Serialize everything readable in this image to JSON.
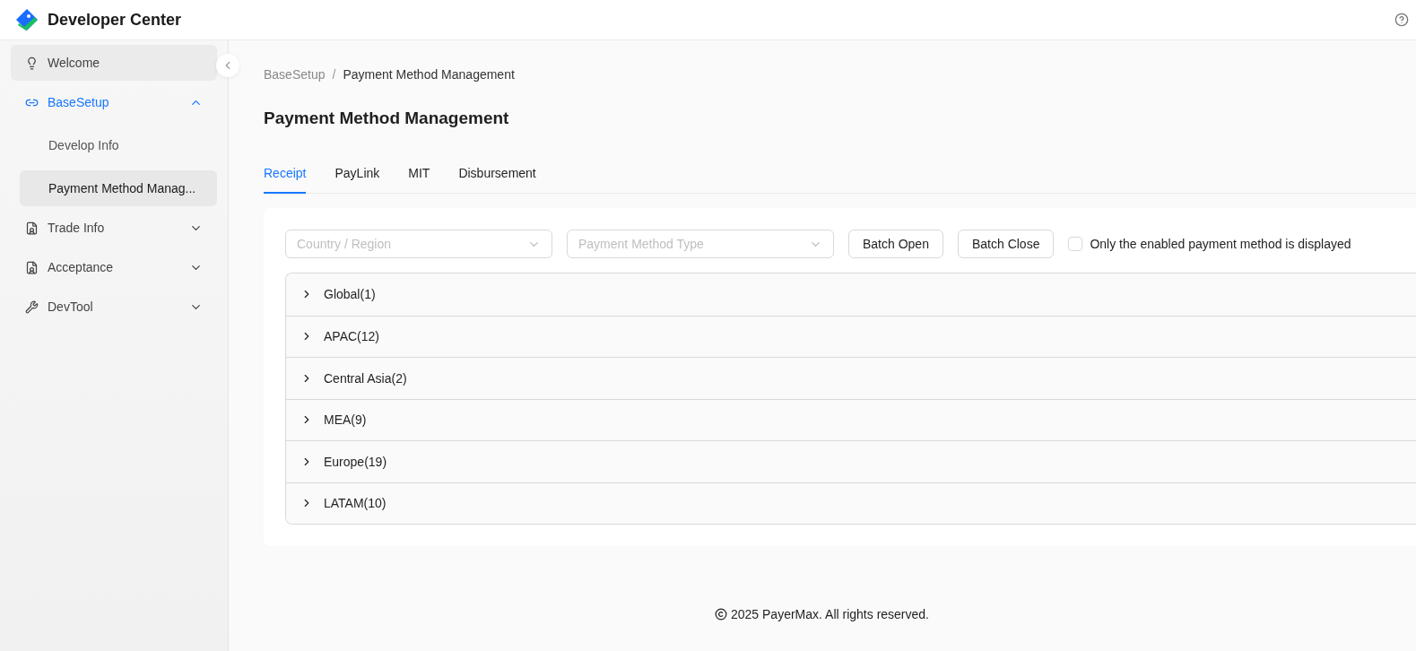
{
  "header": {
    "title": "Developer Center"
  },
  "sidebar": {
    "items": [
      {
        "label": "Welcome",
        "hovered": true,
        "active": false
      },
      {
        "label": "BaseSetup",
        "active": true,
        "expanded": true,
        "children": [
          {
            "label": "Develop Info",
            "selected": false
          },
          {
            "label": "Payment Method Manag...",
            "selected": true
          }
        ]
      },
      {
        "label": "Trade Info",
        "active": false,
        "expanded": false
      },
      {
        "label": "Acceptance",
        "active": false,
        "expanded": false
      },
      {
        "label": "DevTool",
        "active": false,
        "expanded": false
      }
    ]
  },
  "breadcrumb": {
    "separator": "/",
    "items": [
      "BaseSetup",
      "Payment Method Management"
    ]
  },
  "page_title": "Payment Method Management",
  "tabs": [
    {
      "label": "Receipt",
      "selected": true
    },
    {
      "label": "PayLink",
      "selected": false
    },
    {
      "label": "MIT",
      "selected": false
    },
    {
      "label": "Disbursement",
      "selected": false
    }
  ],
  "filters": {
    "selects": [
      {
        "placeholder": "Country / Region"
      },
      {
        "placeholder": "Payment Method Type"
      }
    ],
    "buttons": [
      "Batch Open",
      "Batch Close"
    ],
    "checkbox": {
      "label": "Only the enabled payment method is displayed",
      "checked": false
    }
  },
  "regions": [
    {
      "label": "Global(1)",
      "expanded": false
    },
    {
      "label": "APAC(12)",
      "expanded": false
    },
    {
      "label": "Central Asia(2)",
      "expanded": false
    },
    {
      "label": "MEA(9)",
      "expanded": false
    },
    {
      "label": "Europe(19)",
      "expanded": false
    },
    {
      "label": "LATAM(10)",
      "expanded": false
    }
  ],
  "footer": "2025 PayerMax. All rights reserved."
}
